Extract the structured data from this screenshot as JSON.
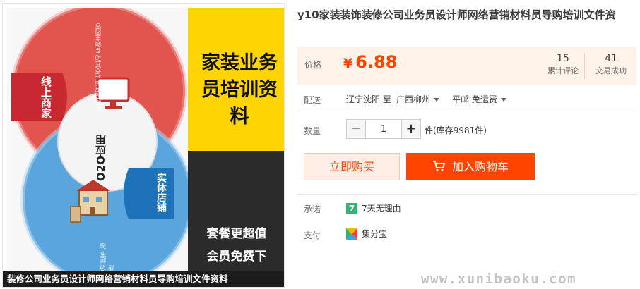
{
  "product": {
    "title": "y10家装装饰装修公司业务员设计师网络营销材料员导购培训文件资",
    "price_label": "价格",
    "currency": "¥",
    "price": "6.88",
    "stats": [
      {
        "value": "15",
        "label": "累计评论"
      },
      {
        "value": "41",
        "label": "交易成功"
      }
    ]
  },
  "shipping": {
    "label": "配送",
    "from": "辽宁沈阳 至",
    "to": "广西柳州",
    "method": "平邮 免运费"
  },
  "quantity": {
    "label": "数量",
    "value": "1",
    "minus": "−",
    "plus": "+",
    "stock_text": "件(库存9981件)"
  },
  "actions": {
    "buy_now": "立即购买",
    "add_to_cart": "加入购物车"
  },
  "promise": {
    "label": "承诺",
    "badge": "7",
    "text": "7天无理由"
  },
  "payment": {
    "label": "支付",
    "text": "集分宝"
  },
  "image": {
    "panel_title": "家装业务员培训资料",
    "promo_line1": "套餐更超值",
    "promo_line2": "会员免费下",
    "caption": "装修公司业务员设计师网络营销材料员导购培训文件资料",
    "tag_left": "线上商家",
    "tag_right": "实体店铺",
    "center_text": "O2O应用",
    "red_small_text": "官网品牌站 社交互动 专题主内容",
    "blue_small_text": "商场 超市 独立店"
  },
  "watermark": "www.xunibaoku.com",
  "colors": {
    "accent": "#ff4400",
    "price_bg": "#fff2e8",
    "panel_yellow": "#ffd400"
  }
}
